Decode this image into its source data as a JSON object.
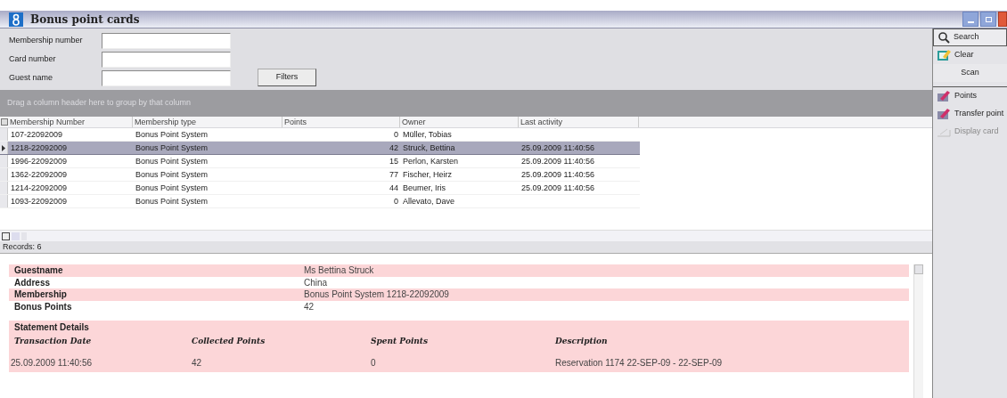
{
  "window": {
    "title": "Bonus point cards"
  },
  "filters": [
    {
      "label": "Membership number"
    },
    {
      "label": "Card number"
    },
    {
      "label": "Guest name"
    }
  ],
  "filters_button": "Filters",
  "group_hint": "Drag a column header here to group by that column",
  "table": {
    "columns": [
      "Membership Number",
      "Membership type",
      "Points",
      "Owner",
      "Last activity"
    ],
    "rows": [
      {
        "selected": false,
        "cells": [
          "107-22092009",
          "Bonus Point System",
          "0",
          "Müller, Tobias",
          ""
        ]
      },
      {
        "selected": true,
        "cells": [
          "1218-22092009",
          "Bonus Point System",
          "42",
          "Struck, Bettina",
          "25.09.2009 11:40:56"
        ]
      },
      {
        "selected": false,
        "cells": [
          "1996-22092009",
          "Bonus Point System",
          "15",
          "Perlon, Karsten",
          "25.09.2009 11:40:56"
        ]
      },
      {
        "selected": false,
        "cells": [
          "1362-22092009",
          "Bonus Point System",
          "77",
          "Fischer, Heirz",
          "25.09.2009 11:40:56"
        ]
      },
      {
        "selected": false,
        "cells": [
          "1214-22092009",
          "Bonus Point System",
          "44",
          "Beumer, Iris",
          "25.09.2009 11:40:56"
        ]
      },
      {
        "selected": false,
        "cells": [
          "1093-22092009",
          "Bonus Point System",
          "0",
          "Allevato, Dave",
          ""
        ]
      }
    ]
  },
  "records": "Records: 6",
  "details": [
    {
      "label": "Guestname",
      "value": "Ms Bettina Struck"
    },
    {
      "label": "Address",
      "value": "China"
    },
    {
      "label": "Membership",
      "value": "Bonus Point System 1218-22092009"
    },
    {
      "label": "Bonus Points",
      "value": "42"
    }
  ],
  "statement": {
    "title": "Statement Details",
    "columns": [
      "Transaction Date",
      "Collected Points",
      "Spent Points",
      "Description"
    ],
    "rows": [
      [
        "25.09.2009 11:40:56",
        "42",
        "0",
        "Reservation 1174 22-SEP-09 - 22-SEP-09"
      ]
    ]
  },
  "toolbar": [
    {
      "kind": "search",
      "label": "Search",
      "disabled": false
    },
    {
      "kind": "clear",
      "label": "Clear",
      "disabled": false
    },
    {
      "kind": "plain",
      "label": "Scan",
      "disabled": false
    },
    {
      "kind": "separator"
    },
    {
      "kind": "points",
      "label": "Points",
      "disabled": false
    },
    {
      "kind": "points",
      "label": "Transfer point",
      "disabled": false
    },
    {
      "kind": "card",
      "label": "Display card",
      "disabled": true
    }
  ]
}
